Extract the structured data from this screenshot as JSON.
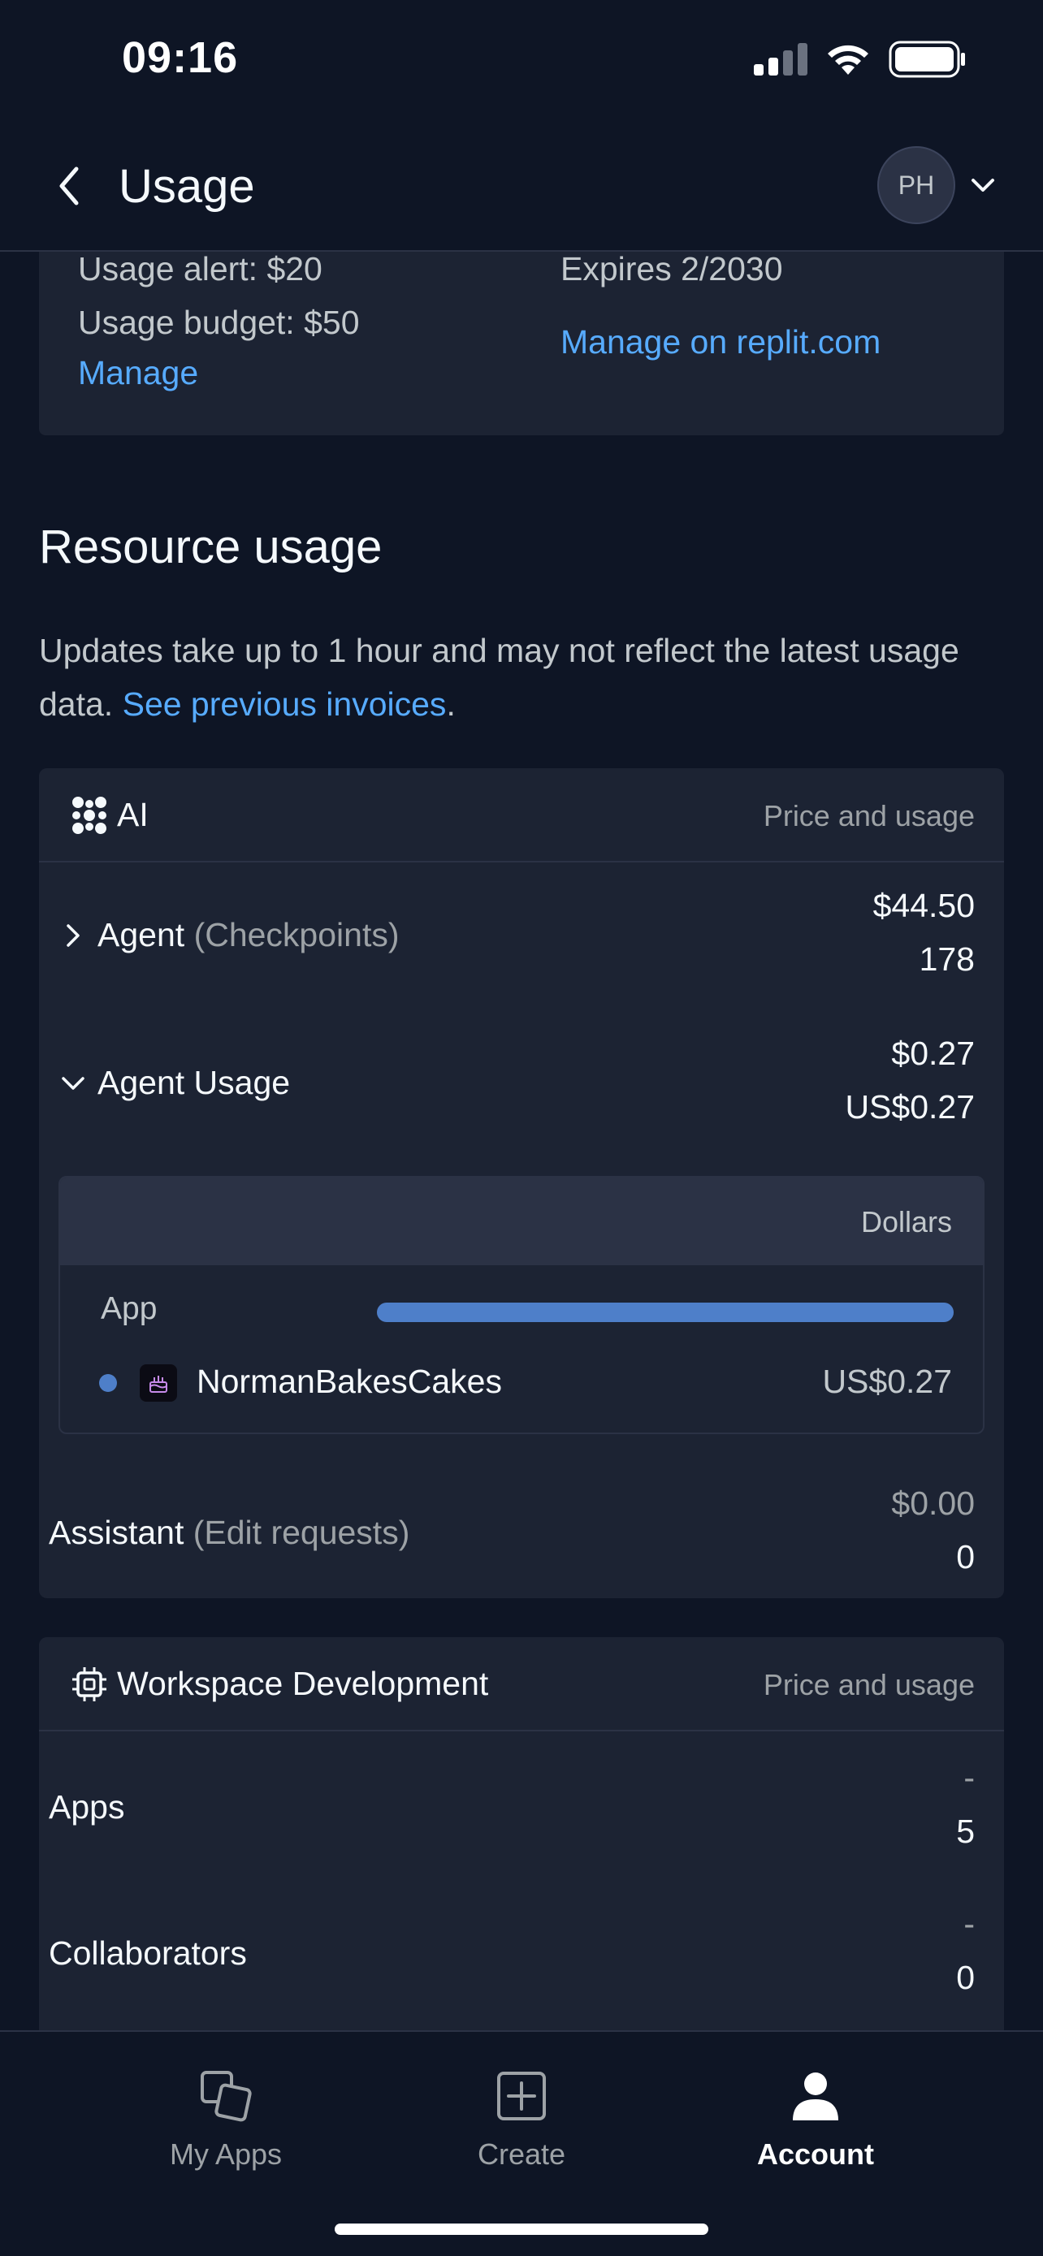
{
  "status_bar": {
    "time": "09:16"
  },
  "header": {
    "title": "Usage",
    "avatar_initials": "PH"
  },
  "plan": {
    "alert": "Usage alert: $20",
    "budget": "Usage budget: $50",
    "manage": "Manage",
    "expires": "Expires 2/2030",
    "manage_external": "Manage on replit.com"
  },
  "resource": {
    "title": "Resource usage",
    "desc_text": "Updates take up to 1 hour and may not reflect the latest usage data. ",
    "desc_link": "See previous invoices",
    "desc_end": "."
  },
  "ai_card": {
    "title": "AI",
    "right_label": "Price and usage",
    "rows": [
      {
        "label": "Agent",
        "sub": "(Checkpoints)",
        "value1": "$44.50",
        "value2": "178",
        "expanded": false
      },
      {
        "label": "Agent Usage",
        "sub": "",
        "value1": "$0.27",
        "value2": "US$0.27",
        "expanded": true
      },
      {
        "label": "Assistant",
        "sub": "(Edit requests)",
        "value1": "$0.00",
        "value2": "0"
      }
    ],
    "breakdown": {
      "header": "Dollars",
      "group_label": "App",
      "bar_fraction": 1.0,
      "items": [
        {
          "name": "NormanBakesCakes",
          "value": "US$0.27",
          "dot_color": "#4E7FC9"
        }
      ]
    }
  },
  "workspace_card": {
    "title": "Workspace Development",
    "right_label": "Price and usage",
    "rows": [
      {
        "label": "Apps",
        "value1": "-",
        "value2": "5"
      },
      {
        "label": "Collaborators",
        "value1": "-",
        "value2": "0"
      }
    ]
  },
  "tabs": [
    {
      "label": "My Apps",
      "icon": "my-apps-icon",
      "active": false
    },
    {
      "label": "Create",
      "icon": "create-icon",
      "active": false
    },
    {
      "label": "Account",
      "icon": "account-icon",
      "active": true
    }
  ],
  "colors": {
    "background": "#0E1525",
    "surface": "#1C2333",
    "border": "#2B3245",
    "link": "#57ABFF",
    "bar": "#4E7FC9"
  }
}
